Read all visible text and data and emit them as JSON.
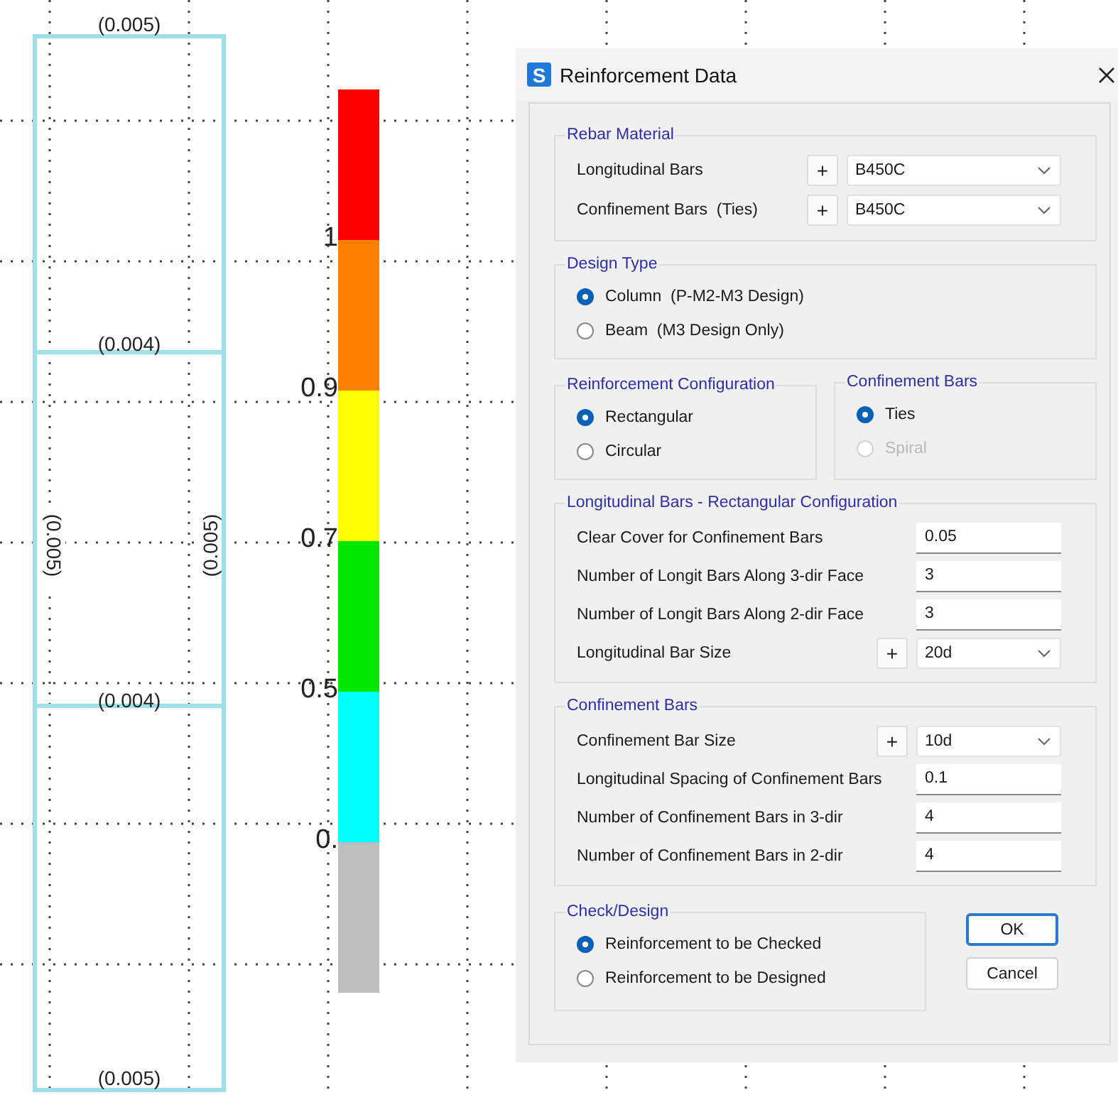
{
  "frame": {
    "top_label": "(0.005)",
    "beam_labels": [
      "(0.004)",
      "(0.004)"
    ],
    "bottom_label": "(0.005)",
    "left_label": "(0.005)",
    "right_label": "(0.005)"
  },
  "legend_bar": {
    "segments": [
      {
        "color": "#ff0000"
      },
      {
        "color": "#ff8000"
      },
      {
        "color": "#ffff00"
      },
      {
        "color": "#00e600"
      },
      {
        "color": "#00ffff"
      },
      {
        "color": "#bebebe"
      }
    ],
    "labels": [
      "1",
      "0.9",
      "0.7",
      "0.5",
      "0."
    ]
  },
  "dialog": {
    "app_icon": "S",
    "title": "Reinforcement Data",
    "rebar_material": {
      "title": "Rebar Material",
      "rows": [
        {
          "kind": "select",
          "label": "Longitudinal Bars",
          "add_button": "+",
          "value": "B450C"
        },
        {
          "kind": "select",
          "label": "Confinement Bars  (Ties)",
          "add_button": "+",
          "value": "B450C"
        }
      ]
    },
    "design_type": {
      "title": "Design Type",
      "options": [
        {
          "label": "Column  (P-M2-M3 Design)",
          "selected": true,
          "disabled": false
        },
        {
          "label": "Beam  (M3 Design Only)",
          "selected": false,
          "disabled": false
        }
      ]
    },
    "reinforcement_configuration": {
      "title": "Reinforcement Configuration",
      "options": [
        {
          "label": "Rectangular",
          "selected": true,
          "disabled": false
        },
        {
          "label": "Circular",
          "selected": false,
          "disabled": false
        }
      ]
    },
    "confinement_type": {
      "title": "Confinement Bars",
      "options": [
        {
          "label": "Ties",
          "selected": true,
          "disabled": false
        },
        {
          "label": "Spiral",
          "selected": false,
          "disabled": true
        }
      ]
    },
    "longitudinal_bars": {
      "title": "Longitudinal Bars - Rectangular Configuration",
      "rows": [
        {
          "kind": "input",
          "label": "Clear Cover for Confinement Bars",
          "value": "0.05"
        },
        {
          "kind": "input",
          "label": "Number of Longit Bars Along 3-dir Face",
          "value": "3"
        },
        {
          "kind": "input",
          "label": "Number of Longit Bars Along 2-dir Face",
          "value": "3"
        },
        {
          "kind": "select",
          "label": "Longitudinal Bar Size",
          "add_button": "+",
          "value": "20d"
        }
      ]
    },
    "confinement_bars": {
      "title": "Confinement Bars",
      "rows": [
        {
          "kind": "select",
          "label": "Confinement Bar Size",
          "add_button": "+",
          "value": "10d"
        },
        {
          "kind": "input",
          "label": "Longitudinal Spacing of Confinement Bars",
          "value": "0.1"
        },
        {
          "kind": "input",
          "label": "Number of Confinement Bars in 3-dir",
          "value": "4"
        },
        {
          "kind": "input",
          "label": "Number of Confinement Bars in 2-dir",
          "value": "4"
        }
      ]
    },
    "check_design": {
      "title": "Check/Design",
      "options": [
        {
          "label": "Reinforcement to be Checked",
          "selected": true,
          "disabled": false
        },
        {
          "label": "Reinforcement to be Designed",
          "selected": false,
          "disabled": false
        }
      ]
    },
    "buttons": [
      {
        "label": "OK",
        "default": true
      },
      {
        "label": "Cancel",
        "default": false
      }
    ]
  }
}
